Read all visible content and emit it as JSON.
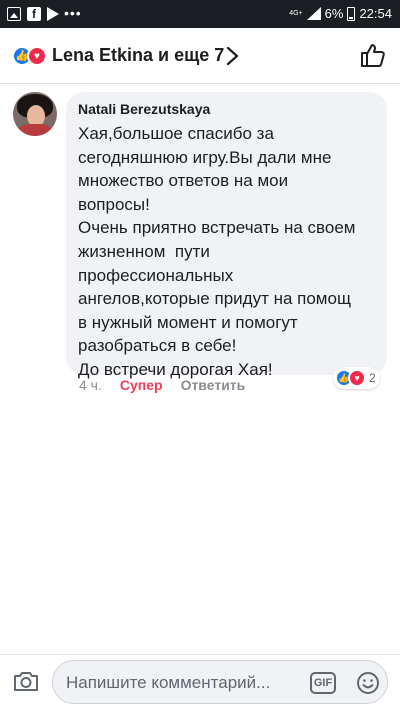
{
  "status_bar": {
    "network": "4G+",
    "battery": "6%",
    "time": "22:54"
  },
  "header": {
    "title": "Lena Etkina и еще 7",
    "reaction_icons": [
      "like-icon",
      "love-icon"
    ]
  },
  "comment": {
    "author": "Natali Berezutskaya",
    "text": "Хая,большое спасибо за\nсегодняшнюю игру.Вы дали мне\nмножество ответов на мои\nвопросы!\nОчень приятно встречать на своем\nжизненном  пути\nпрофессиональных\nангелов,которые придут на помощ\nв нужный момент и помогут\nразобраться в себе!\nДо встречи дорогая Хая!",
    "time": "4 ч.",
    "reaction_label": "Супер",
    "reply_label": "Ответить",
    "reaction_count": "2"
  },
  "composer": {
    "placeholder": "Напишите комментарий...",
    "gif_label": "GIF"
  },
  "colors": {
    "like_blue": "#1877f2",
    "love_red": "#f02849",
    "super_text": "#f33e58",
    "bubble_bg": "#f0f2f5"
  }
}
